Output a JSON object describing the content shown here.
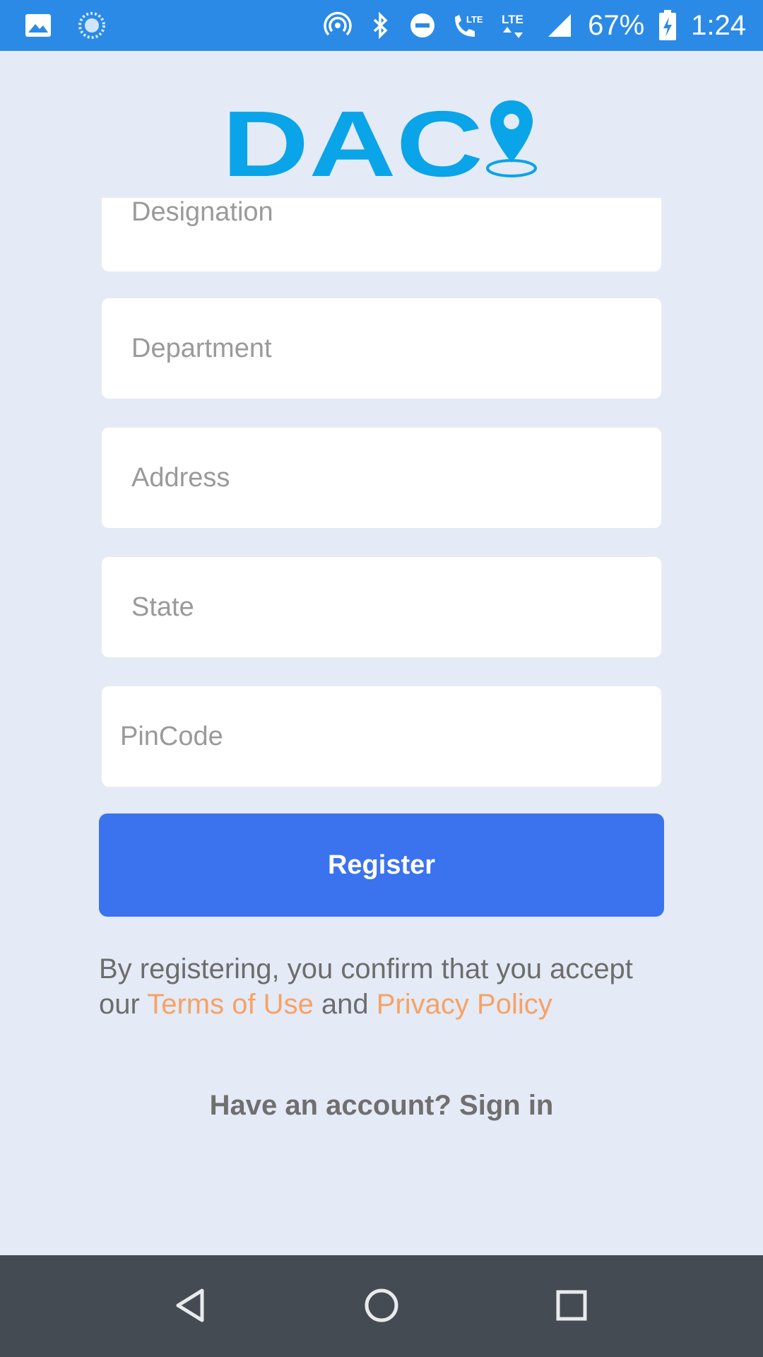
{
  "status_bar": {
    "battery": "67%",
    "time": "1:24",
    "icons": [
      "image-icon",
      "sync-icon",
      "hotspot-icon",
      "bluetooth-icon",
      "dnd-icon",
      "volte-call-icon",
      "lte-data-icon",
      "signal-icon",
      "battery-charging-icon"
    ],
    "lte_label": "LTE"
  },
  "logo": {
    "text": "DAC",
    "accent": "#0aa4e8"
  },
  "form": {
    "fields": [
      {
        "placeholder": "Designation"
      },
      {
        "placeholder": "Department"
      },
      {
        "placeholder": "Address"
      },
      {
        "placeholder": "State"
      },
      {
        "placeholder": "PinCode"
      }
    ]
  },
  "register_label": "Register",
  "terms": {
    "prefix": "By registering, you confirm that you accept our ",
    "terms_link": "Terms of Use",
    "middle": " and ",
    "privacy_link": "Privacy Policy"
  },
  "signin_text": "Have an account? Sign in",
  "colors": {
    "primary": "#3b73ef",
    "status_bar": "#2b8ae6",
    "link": "#f7a265",
    "background": "#e4eaf6"
  },
  "nav": {
    "icons": [
      "back-icon",
      "home-icon",
      "recents-icon"
    ]
  }
}
